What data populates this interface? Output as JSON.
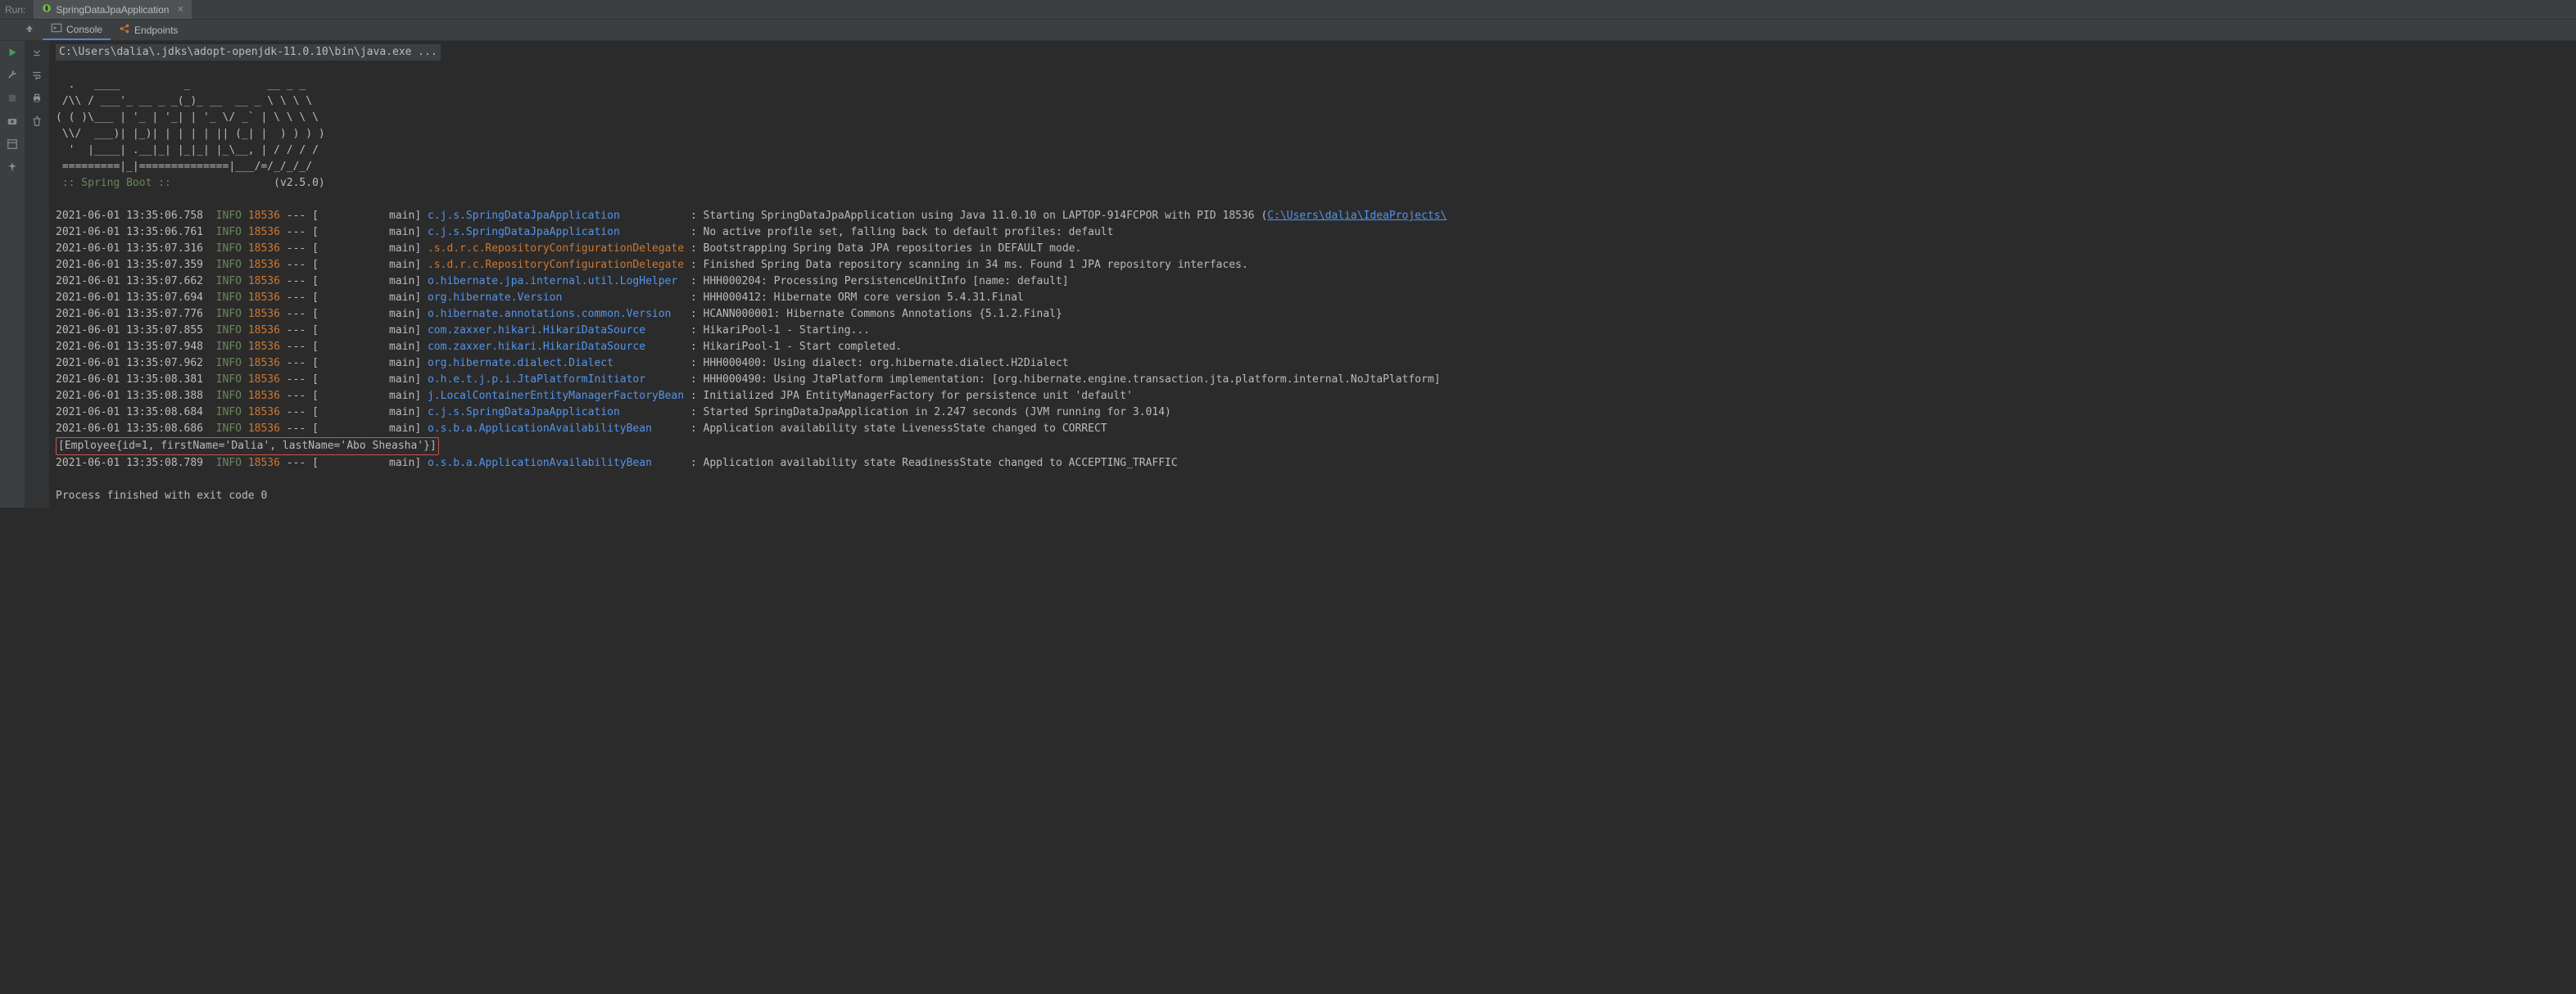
{
  "topBar": {
    "labelRun": "Run:",
    "tabName": "SpringDataJpaApplication",
    "closeIcon": "×"
  },
  "toolTabs": {
    "console": "Console",
    "endpoints": "Endpoints"
  },
  "console": {
    "commandLine": "C:\\Users\\dalia\\.jdks\\adopt-openjdk-11.0.10\\bin\\java.exe ...",
    "asciiArt": [
      "  .   ____          _            __ _ _",
      " /\\\\ / ___'_ __ _ _(_)_ __  __ _ \\ \\ \\ \\",
      "( ( )\\___ | '_ | '_| | '_ \\/ _` | \\ \\ \\ \\",
      " \\\\/  ___)| |_)| | | | | || (_| |  ) ) ) )",
      "  '  |____| .__|_| |_|_| |_\\__, | / / / /",
      " =========|_|==============|___/=/_/_/_/"
    ],
    "bootLabel": " :: Spring Boot :: ",
    "bootVersion": "               (v2.5.0)",
    "logs": [
      {
        "ts": "2021-06-01 13:35:06.758",
        "level": "INFO",
        "pid": "18536",
        "thread": "main",
        "logger": "c.j.s.SpringDataJpaApplication",
        "loggerColor": "blue",
        "msg": "Starting SpringDataJpaApplication using Java 11.0.10 on LAPTOP-914FCPOR with PID 18536 (",
        "link": "C:\\Users\\dalia\\IdeaProjects\\"
      },
      {
        "ts": "2021-06-01 13:35:06.761",
        "level": "INFO",
        "pid": "18536",
        "thread": "main",
        "logger": "c.j.s.SpringDataJpaApplication",
        "loggerColor": "blue",
        "msg": "No active profile set, falling back to default profiles: default"
      },
      {
        "ts": "2021-06-01 13:35:07.316",
        "level": "INFO",
        "pid": "18536",
        "thread": "main",
        "logger": ".s.d.r.c.RepositoryConfigurationDelegate",
        "loggerColor": "orange",
        "msg": "Bootstrapping Spring Data JPA repositories in DEFAULT mode."
      },
      {
        "ts": "2021-06-01 13:35:07.359",
        "level": "INFO",
        "pid": "18536",
        "thread": "main",
        "logger": ".s.d.r.c.RepositoryConfigurationDelegate",
        "loggerColor": "orange",
        "msg": "Finished Spring Data repository scanning in 34 ms. Found 1 JPA repository interfaces."
      },
      {
        "ts": "2021-06-01 13:35:07.662",
        "level": "INFO",
        "pid": "18536",
        "thread": "main",
        "logger": "o.hibernate.jpa.internal.util.LogHelper",
        "loggerColor": "blue",
        "msg": "HHH000204: Processing PersistenceUnitInfo [name: default]"
      },
      {
        "ts": "2021-06-01 13:35:07.694",
        "level": "INFO",
        "pid": "18536",
        "thread": "main",
        "logger": "org.hibernate.Version",
        "loggerColor": "blue",
        "msg": "HHH000412: Hibernate ORM core version 5.4.31.Final"
      },
      {
        "ts": "2021-06-01 13:35:07.776",
        "level": "INFO",
        "pid": "18536",
        "thread": "main",
        "logger": "o.hibernate.annotations.common.Version",
        "loggerColor": "blue",
        "msg": "HCANN000001: Hibernate Commons Annotations {5.1.2.Final}"
      },
      {
        "ts": "2021-06-01 13:35:07.855",
        "level": "INFO",
        "pid": "18536",
        "thread": "main",
        "logger": "com.zaxxer.hikari.HikariDataSource",
        "loggerColor": "blue",
        "msg": "HikariPool-1 - Starting..."
      },
      {
        "ts": "2021-06-01 13:35:07.948",
        "level": "INFO",
        "pid": "18536",
        "thread": "main",
        "logger": "com.zaxxer.hikari.HikariDataSource",
        "loggerColor": "blue",
        "msg": "HikariPool-1 - Start completed."
      },
      {
        "ts": "2021-06-01 13:35:07.962",
        "level": "INFO",
        "pid": "18536",
        "thread": "main",
        "logger": "org.hibernate.dialect.Dialect",
        "loggerColor": "blue",
        "msg": "HHH000400: Using dialect: org.hibernate.dialect.H2Dialect"
      },
      {
        "ts": "2021-06-01 13:35:08.381",
        "level": "INFO",
        "pid": "18536",
        "thread": "main",
        "logger": "o.h.e.t.j.p.i.JtaPlatformInitiator",
        "loggerColor": "blue",
        "msg": "HHH000490: Using JtaPlatform implementation: [org.hibernate.engine.transaction.jta.platform.internal.NoJtaPlatform]"
      },
      {
        "ts": "2021-06-01 13:35:08.388",
        "level": "INFO",
        "pid": "18536",
        "thread": "main",
        "logger": "j.LocalContainerEntityManagerFactoryBean",
        "loggerColor": "blue",
        "msg": "Initialized JPA EntityManagerFactory for persistence unit 'default'"
      },
      {
        "ts": "2021-06-01 13:35:08.684",
        "level": "INFO",
        "pid": "18536",
        "thread": "main",
        "logger": "c.j.s.SpringDataJpaApplication",
        "loggerColor": "blue",
        "msg": "Started SpringDataJpaApplication in 2.247 seconds (JVM running for 3.014)"
      },
      {
        "ts": "2021-06-01 13:35:08.686",
        "level": "INFO",
        "pid": "18536",
        "thread": "main",
        "logger": "o.s.b.a.ApplicationAvailabilityBean",
        "loggerColor": "blue",
        "msg": "Application availability state LivenessState changed to CORRECT"
      }
    ],
    "highlighted": "[Employee{id=1, firstName='Dalia', lastName='Abo Sheasha'}]",
    "afterHighlight": {
      "ts": "2021-06-01 13:35:08.789",
      "level": "INFO",
      "pid": "18536",
      "thread": "main",
      "logger": "o.s.b.a.ApplicationAvailabilityBean",
      "loggerColor": "blue",
      "msg": "Application availability state ReadinessState changed to ACCEPTING_TRAFFIC"
    },
    "exitLine": "Process finished with exit code 0"
  }
}
